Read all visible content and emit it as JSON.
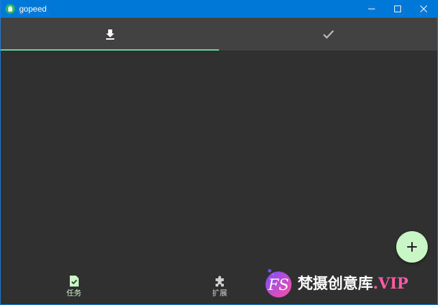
{
  "window": {
    "title": "gopeed",
    "controls": [
      "minimize",
      "maximize",
      "close"
    ]
  },
  "tabs": [
    {
      "icon": "download-icon",
      "selected": true
    },
    {
      "icon": "check-icon",
      "selected": false
    }
  ],
  "fab": {
    "icon": "plus-icon"
  },
  "bottom_nav": {
    "items": [
      {
        "label": "任务",
        "icon": "task-check-icon",
        "selected": true
      },
      {
        "label": "扩展",
        "icon": "puzzle-icon",
        "selected": false
      }
    ]
  },
  "watermark": {
    "logo_text": "FS",
    "text": "梵摄创意库",
    "suffix": ".VIP"
  },
  "colors": {
    "titlebar": "#0078d7",
    "tabbar": "#424242",
    "background": "#303030",
    "accent": "#62d7a3",
    "fab": "#c8f7c5"
  }
}
